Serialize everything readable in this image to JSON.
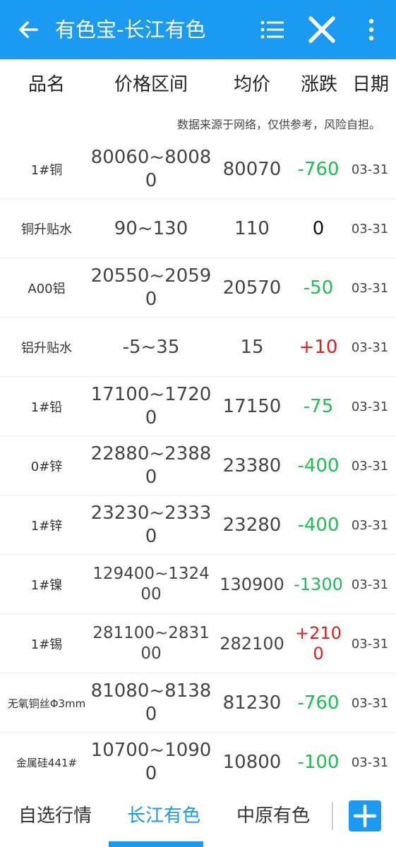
{
  "app": {
    "title": "有色宝-长江有色",
    "accent_color": "#1a9af0",
    "icons": [
      "back-arrow-icon",
      "list-icon",
      "close-icon",
      "more-vertical-icon",
      "plus-icon"
    ]
  },
  "table": {
    "headers": {
      "name": "品名",
      "range": "价格区间",
      "avg": "均价",
      "change": "涨跌",
      "date": "日期"
    },
    "notice": "数据来源于网络，仅供参考，风险自担。",
    "colors": {
      "down": "#1dbf4e",
      "up": "#e02020",
      "flat": "#111111"
    },
    "rows": [
      {
        "name": "1#铜",
        "range": "80060~80080",
        "avg": "80070",
        "change": "-760",
        "trend": "down",
        "date": "03-31"
      },
      {
        "name": "铜升贴水",
        "range": "90~130",
        "avg": "110",
        "change": "0",
        "trend": "flat",
        "date": "03-31"
      },
      {
        "name": "A00铝",
        "range": "20550~20590",
        "avg": "20570",
        "change": "-50",
        "trend": "down",
        "date": "03-31"
      },
      {
        "name": "铝升贴水",
        "range": "-5~35",
        "avg": "15",
        "change": "+10",
        "trend": "up",
        "date": "03-31"
      },
      {
        "name": "1#铅",
        "range": "17100~17200",
        "avg": "17150",
        "change": "-75",
        "trend": "down",
        "date": "03-31"
      },
      {
        "name": "0#锌",
        "range": "22880~23880",
        "avg": "23380",
        "change": "-400",
        "trend": "down",
        "date": "03-31"
      },
      {
        "name": "1#锌",
        "range": "23230~23330",
        "avg": "23280",
        "change": "-400",
        "trend": "down",
        "date": "03-31"
      },
      {
        "name": "1#镍",
        "range": "129400~132400",
        "avg": "130900",
        "change": "-1300",
        "trend": "down",
        "date": "03-31"
      },
      {
        "name": "1#锡",
        "range": "281100~283100",
        "avg": "282100",
        "change": "+2100",
        "trend": "up",
        "date": "03-31"
      },
      {
        "name": "无氧铜丝Φ3mm",
        "range": "81080~81380",
        "avg": "81230",
        "change": "-760",
        "trend": "down",
        "date": "03-31"
      },
      {
        "name": "金属硅441#",
        "range": "10700~10900",
        "avg": "10800",
        "change": "-100",
        "trend": "down",
        "date": "03-31"
      }
    ]
  },
  "tabs": [
    {
      "label": "自选行情",
      "active": false
    },
    {
      "label": "长江有色",
      "active": true
    },
    {
      "label": "中原有色",
      "active": false
    }
  ]
}
